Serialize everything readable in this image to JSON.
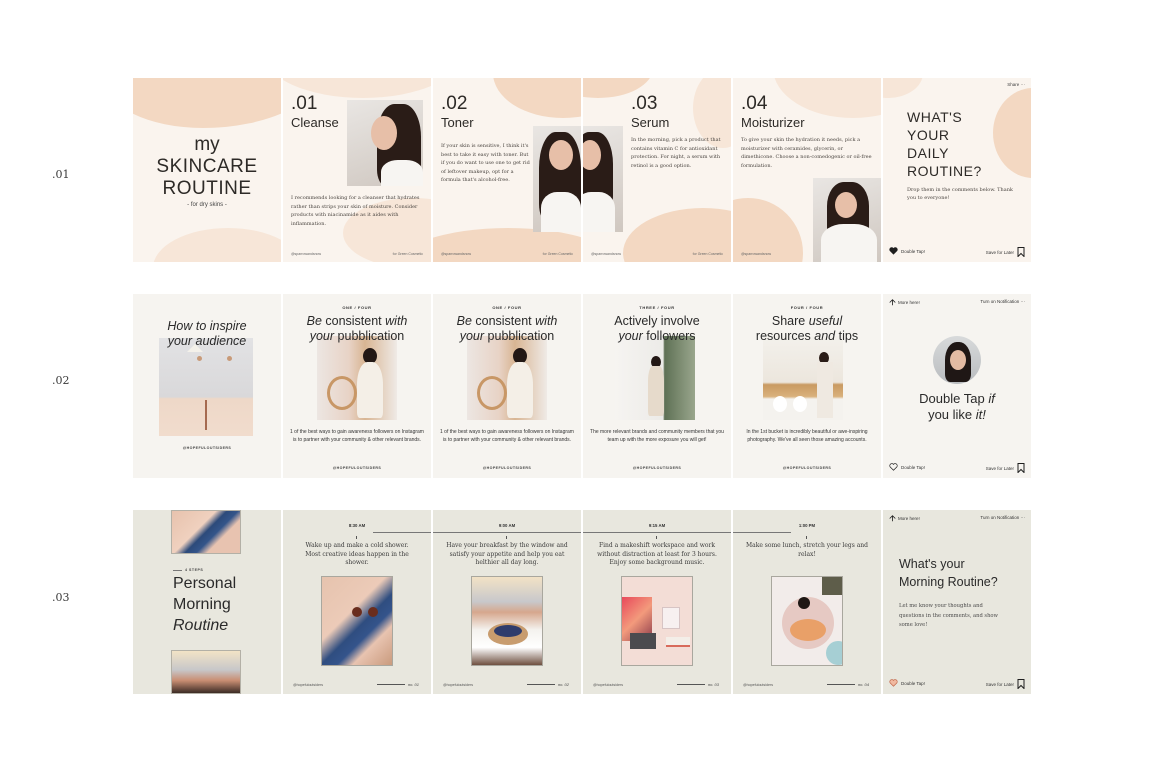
{
  "row_labels": [
    ".01",
    ".02",
    ".03"
  ],
  "colors": {
    "row1_bg": "#faf4ee",
    "row1_accent": "#f3d8c2",
    "row2_bg": "#f6f4f0",
    "row3_bg": "#e8e7de",
    "text": "#2d2a27"
  },
  "row1": {
    "cover": {
      "line1": "my",
      "line2": "SKINCARE",
      "line3": "ROUTINE",
      "subtitle": "- for dry skins -"
    },
    "steps": [
      {
        "number": ".01",
        "title": "Cleanse",
        "body": "I recommends looking for a cleanser that hydrates rather than strips your skin of moisture. Consider products with niacinamide as it aides with inflammation.",
        "handle": "@sparrowandsnow",
        "brand": "for Green Cosmetic"
      },
      {
        "number": ".02",
        "title": "Toner",
        "body": "If your skin is sensitive, I think it's best to take it easy with toner. But if you do want to use one to get rid of leftover makeup, opt for a formula that's alcohol-free.",
        "handle": "@sparrowandsnow",
        "brand": "for Green Cosmetic"
      },
      {
        "number": ".03",
        "title": "Serum",
        "body": "In the morning, pick a product that contains vitamin C for antioxidant protection. For night, a serum with retinol is a good option.",
        "handle": "@sparrowandsnow",
        "brand": "for Green Cosmetic"
      },
      {
        "number": ".04",
        "title": "Moisturizer",
        "body": "To give your skin the hydration it needs, pick a moisturizer with ceramides, glycerin, or dimethicone. Choose a non-comedogenic or oil-free formulation.",
        "handle": "@sparrowandsnow",
        "brand": "for Green Cosmetic"
      }
    ],
    "closing": {
      "share": "Share ···",
      "line1": "WHAT'S",
      "line2": "YOUR",
      "line3": "DAILY",
      "line4": "ROUTINE?",
      "sub": "Drop them in the comments below. Thank you to everyone!",
      "double_tap": "Double Tap!",
      "save": "Save for Later"
    }
  },
  "row2": {
    "cover": {
      "title_line1": "How to inspire",
      "title_line2": "your audience",
      "handle": "@HOPEFULOUTSIDERS"
    },
    "tips": [
      {
        "kicker": "ONE / FOUR",
        "t1a": "Be",
        "t1b": " consistent ",
        "t1c": "with",
        "t2a": "your",
        "t2b": " pubblication",
        "body": "1 of the best ways to gain awareness followers on Instagram is to partner with your community & other relevant brands.",
        "handle": "@HOPEFULOUTSIDERS"
      },
      {
        "kicker": "ONE / FOUR",
        "t1a": "Be",
        "t1b": " consistent ",
        "t1c": "with",
        "t2a": "your",
        "t2b": " pubblication",
        "body": "1 of the best ways to gain awareness followers on Instagram is to partner with your community & other relevant brands.",
        "handle": "@HOPEFULOUTSIDERS"
      },
      {
        "kicker": "THREE / FOUR",
        "t1a": "",
        "t1b": "Actively involve",
        "t1c": "",
        "t2a": "your",
        "t2b": " followers",
        "body": "The more relevant brands and community members that you team up with the more exposure you will get!",
        "handle": "@HOPEFULOUTSIDERS"
      },
      {
        "kicker": "FOUR / FOUR",
        "t1a": "",
        "t1b": "Share ",
        "t1c": "useful",
        "t2a": "",
        "t2b": "resources ",
        "t2c": "and",
        "t2d": " tips",
        "body": "In the 1st bucket is incredibly beautiful or awe-inspiring photography. We've all seen those amazing accounts.",
        "handle": "@HOPEFULOUTSIDERS"
      }
    ],
    "closing": {
      "more": "More here!",
      "notification": "Turn on Notification ···",
      "line1a": "Double Tap ",
      "line1b": "if",
      "line2a": "you like ",
      "line2b": "it!",
      "double_tap": "Double Tap!",
      "save": "Save for Later"
    }
  },
  "row3": {
    "cover": {
      "steps": "4 STEPS",
      "line1": "Personal",
      "line2": "Morning",
      "line3": "Routine"
    },
    "steps": [
      {
        "time": "8:30 AM",
        "body": "Wake up and make a cold shower. Most creative ideas happen in the shower.",
        "handle": "@hopefuloutsiders",
        "no": "no. 01"
      },
      {
        "time": "9:00 AM",
        "body": "Have your breakfast by the window and satisfy your appetite and help you eat helthier all day long.",
        "handle": "@hopefuloutsiders",
        "no": "no. 02"
      },
      {
        "time": "9:15 AM",
        "body": "Find a makeshift workspace and work without distraction at least for 3 hours. Enjoy some background music.",
        "handle": "@hopefuloutsiders",
        "no": "no. 03"
      },
      {
        "time": "1:00 PM",
        "body": "Make some lunch, stretch your legs and relax!",
        "handle": "@hopefuloutsiders",
        "no": "no. 04"
      }
    ],
    "closing": {
      "more": "More here!",
      "notification": "Turn on Notification ···",
      "line1": "What's your",
      "line2": "Morning Routine?",
      "sub": "Let me know your thoughts and questions in the comments, and show some love!",
      "double_tap": "Double Tap!",
      "save": "Save for Later"
    }
  }
}
